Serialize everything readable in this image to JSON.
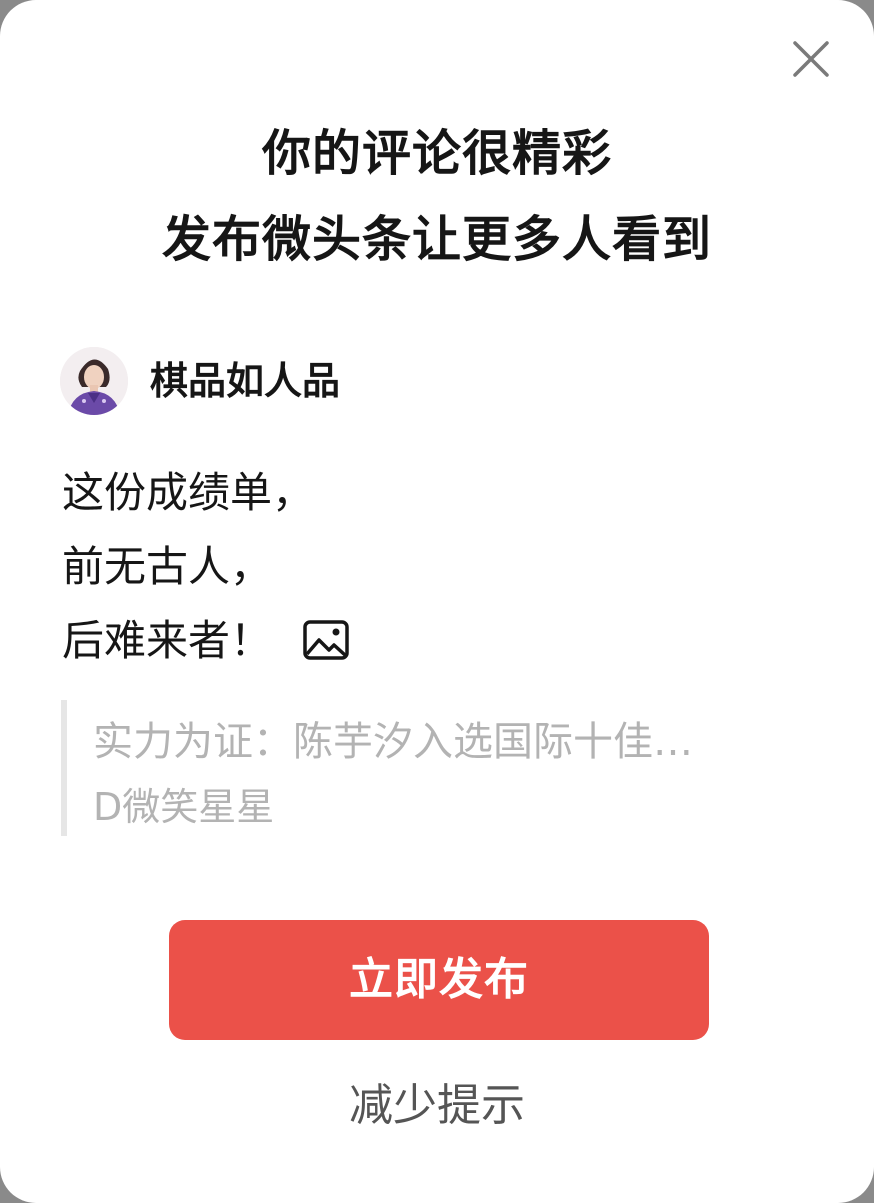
{
  "dialog": {
    "close_icon": "close-icon",
    "headline_line1": "你的评论很精彩",
    "headline_line2": "发布微头条让更多人看到"
  },
  "author": {
    "name": "棋品如人品",
    "avatar_icon": "avatar"
  },
  "comment": {
    "line1": "这份成绩单，",
    "line2": "前无古人，",
    "line3": "后难来者！",
    "image_icon": "image-icon"
  },
  "quote": {
    "title": "实力为证：陈芋汐入选国际十佳…",
    "source": "D微笑星星"
  },
  "actions": {
    "publish_label": "立即发布",
    "reduce_label": "减少提示"
  },
  "colors": {
    "accent": "#eb5149",
    "muted_text": "#b3b3b3"
  }
}
